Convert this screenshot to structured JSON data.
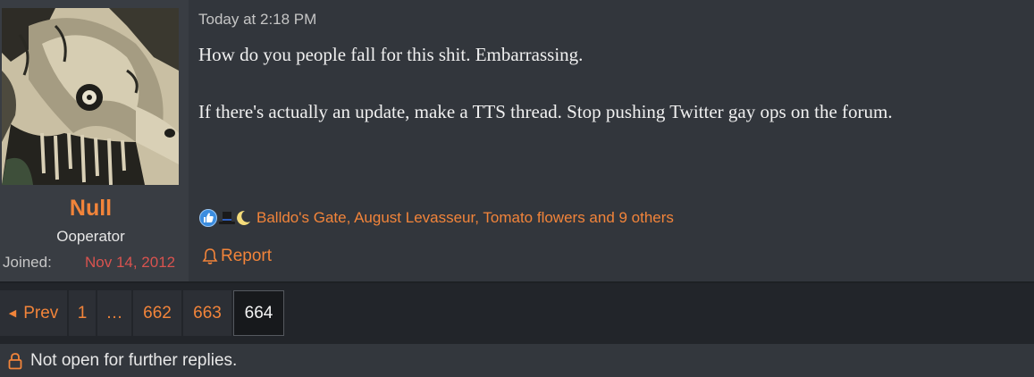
{
  "post": {
    "author": {
      "name": "Null",
      "title": "Ooperator",
      "joined_label": "Joined:",
      "joined_value": "Nov 14, 2012"
    },
    "timestamp": "Today at 2:18 PM",
    "body": [
      "How do you people fall for this shit. Embarrassing.",
      "If there's actually an update, make a TTS thread. Stop pushing Twitter gay ops on the forum."
    ],
    "reactions": {
      "icons": [
        "like-icon",
        "top-hat-icon",
        "crescent-moon-icon"
      ],
      "users_text": "Balldo's Gate, August Levasseur, Tomato flowers and 9 others"
    },
    "report_label": "Report"
  },
  "pagination": {
    "prev_label": "Prev",
    "pages": [
      "1",
      "…",
      "662",
      "663",
      "664"
    ],
    "current": "664"
  },
  "thread_status": {
    "icon": "lock-icon",
    "text": "Not open for further replies."
  },
  "colors": {
    "accent": "#f2843a",
    "joined_date": "#d9534f",
    "page_bg": "#22252a",
    "post_bg": "#32363c",
    "user_col_bg": "#393d43"
  }
}
